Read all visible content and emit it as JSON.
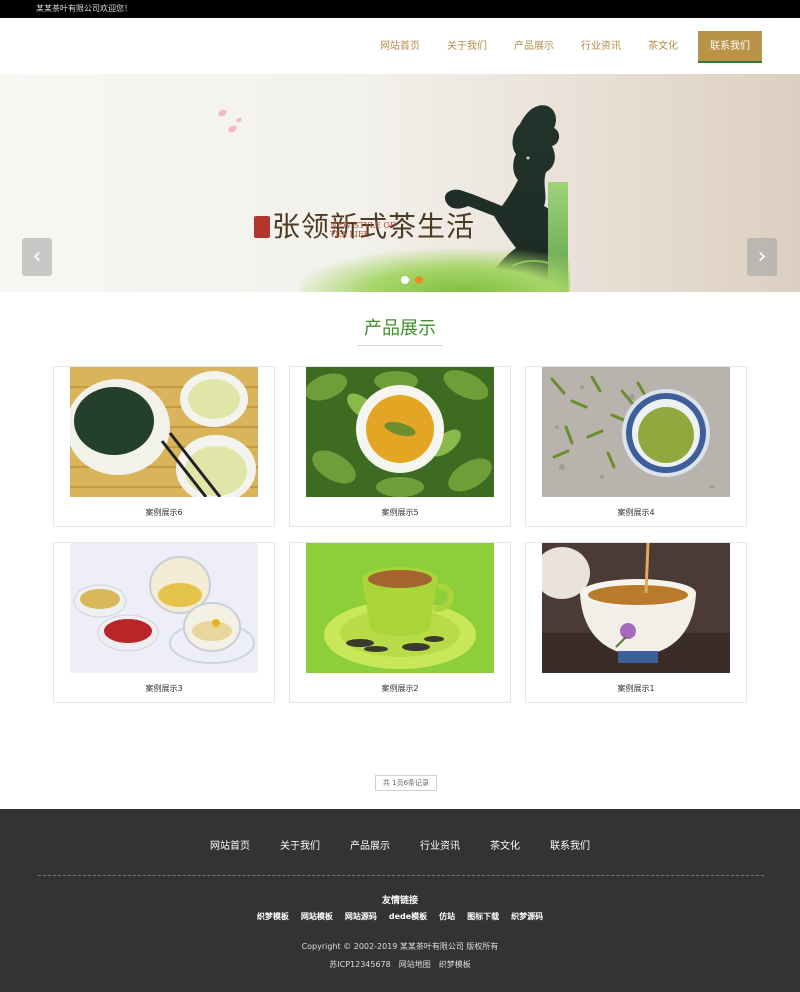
{
  "topbar": {
    "welcome": "某某茶叶有限公司欢迎您！"
  },
  "nav": {
    "items": [
      "网站首页",
      "关于我们",
      "产品展示",
      "行业资讯",
      "茶文化"
    ],
    "active": "联系我们"
  },
  "banner": {
    "slogan_cn": "张领新式茶生活",
    "slogan_en": "NEW STYLE OF TEA LIFE",
    "prev_icon": "chevron-left-icon",
    "next_icon": "chevron-right-icon",
    "prev_glyph": "‹",
    "next_glyph": "›"
  },
  "section": {
    "title": "产品展示"
  },
  "products": [
    {
      "caption": "案例展示6"
    },
    {
      "caption": "案例展示5"
    },
    {
      "caption": "案例展示4"
    },
    {
      "caption": "案例展示3"
    },
    {
      "caption": "案例展示2"
    },
    {
      "caption": "案例展示1"
    }
  ],
  "pager": {
    "text": "共 1页6条记录"
  },
  "footer": {
    "nav": [
      "网站首页",
      "关于我们",
      "产品展示",
      "行业资讯",
      "茶文化",
      "联系我们"
    ],
    "links_title": "友情链接",
    "links": [
      "织梦模板",
      "网站模板",
      "网站源码",
      "dede模板",
      "仿站",
      "图标下载",
      "织梦源码"
    ],
    "copyright": "Copyright © 2002-2019 某某茶叶有限公司 版权所有",
    "icp": "苏ICP12345678",
    "sitemap": "网站地图",
    "dede": "织梦模板"
  }
}
